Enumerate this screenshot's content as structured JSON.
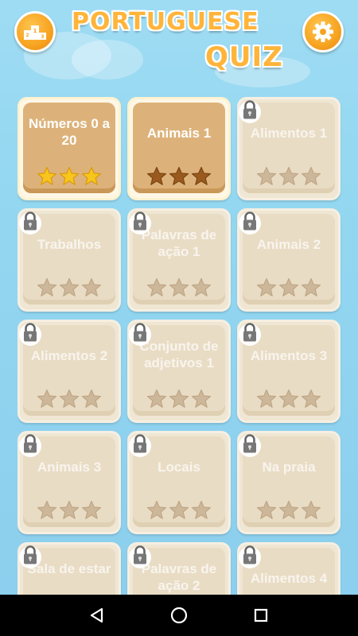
{
  "header": {
    "title_line1": "PORTUGUESE",
    "title_line2": "QUIZ",
    "leaderboard_icon": "podium-icon",
    "settings_icon": "gear-icon"
  },
  "colors": {
    "background": "#92d6f0",
    "accent_orange": "#f7a321",
    "star_gold": "#f8c51c",
    "star_brown": "#9a5a1e",
    "star_locked": "#cdb79a"
  },
  "levels": [
    {
      "label": "Números 0 a 20",
      "locked": false,
      "stars": 3,
      "star_style": "gold"
    },
    {
      "label": "Animais 1",
      "locked": false,
      "stars": 3,
      "star_style": "brown"
    },
    {
      "label": "Alimentos 1",
      "locked": true,
      "stars": 3,
      "star_style": "locked"
    },
    {
      "label": "Trabalhos",
      "locked": true,
      "stars": 3,
      "star_style": "locked"
    },
    {
      "label": "Palavras de ação 1",
      "locked": true,
      "stars": 3,
      "star_style": "locked"
    },
    {
      "label": "Animais 2",
      "locked": true,
      "stars": 3,
      "star_style": "locked"
    },
    {
      "label": "Alimentos 2",
      "locked": true,
      "stars": 3,
      "star_style": "locked"
    },
    {
      "label": "Conjunto de adjetivos 1",
      "locked": true,
      "stars": 3,
      "star_style": "locked"
    },
    {
      "label": "Alimentos 3",
      "locked": true,
      "stars": 3,
      "star_style": "locked"
    },
    {
      "label": "Animais 3",
      "locked": true,
      "stars": 3,
      "star_style": "locked"
    },
    {
      "label": "Locais",
      "locked": true,
      "stars": 3,
      "star_style": "locked"
    },
    {
      "label": "Na praia",
      "locked": true,
      "stars": 3,
      "star_style": "locked"
    },
    {
      "label": "Sala de estar",
      "locked": true,
      "stars": 3,
      "star_style": "locked"
    },
    {
      "label": "Palavras de ação 2",
      "locked": true,
      "stars": 3,
      "star_style": "locked"
    },
    {
      "label": "Alimentos 4",
      "locked": true,
      "stars": 3,
      "star_style": "locked"
    }
  ],
  "navbar": {
    "back_icon": "back-triangle-icon",
    "home_icon": "home-circle-icon",
    "recents_icon": "recents-square-icon"
  }
}
